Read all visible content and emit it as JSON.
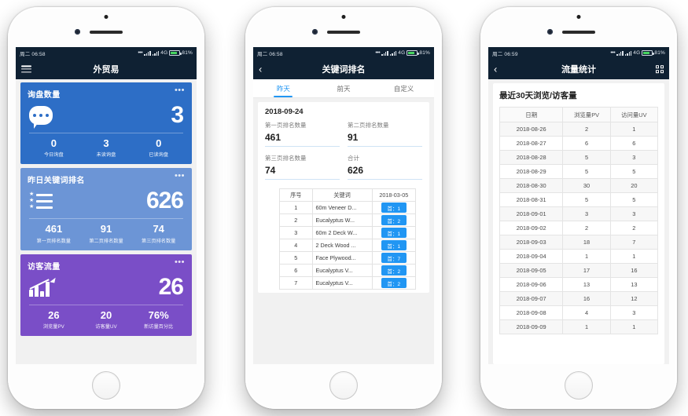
{
  "status_bar": {
    "day_time": "周二 06:58",
    "day_time_3": "周二 06:59",
    "network": "4G",
    "battery": "81%"
  },
  "phone1": {
    "nav_title": "外贸易",
    "cards": [
      {
        "title": "询盘数量",
        "icon": "speech-bubble-icon",
        "big_value": "3",
        "color": "#2d6ec6",
        "stats": [
          {
            "value": "0",
            "label": "今日询盘"
          },
          {
            "value": "3",
            "label": "未读询盘"
          },
          {
            "value": "0",
            "label": "已读询盘"
          }
        ]
      },
      {
        "title": "昨日关键词排名",
        "icon": "star-list-icon",
        "big_value": "626",
        "color": "#6c95d6",
        "stats": [
          {
            "value": "461",
            "label": "第一页排名数量"
          },
          {
            "value": "91",
            "label": "第二页排名数量"
          },
          {
            "value": "74",
            "label": "第三页排名数量"
          }
        ]
      },
      {
        "title": "访客流量",
        "icon": "growth-chart-icon",
        "big_value": "26",
        "color": "#7a4ec7",
        "stats": [
          {
            "value": "26",
            "label": "浏览量PV"
          },
          {
            "value": "20",
            "label": "访客量UV"
          },
          {
            "value": "76%",
            "label": "新访量百分比"
          }
        ]
      }
    ]
  },
  "phone2": {
    "nav_title": "关键词排名",
    "tabs": [
      {
        "label": "昨天",
        "active": true
      },
      {
        "label": "前天",
        "active": false
      },
      {
        "label": "自定义",
        "active": false
      }
    ],
    "panel_date": "2018-09-24",
    "fields": [
      {
        "label": "第一页排名数量",
        "value": "461"
      },
      {
        "label": "第二页排名数量",
        "value": "91"
      },
      {
        "label": "第三页排名数量",
        "value": "74"
      },
      {
        "label": "合计",
        "value": "626"
      }
    ],
    "keyword_table": {
      "headers": [
        "序号",
        "关键词",
        "2018-03-05"
      ],
      "rows": [
        [
          "1",
          "60m Veneer D...",
          "首：1"
        ],
        [
          "2",
          "Eucalyptus W...",
          "首：2"
        ],
        [
          "3",
          "60m 2 Deck W...",
          "首：1"
        ],
        [
          "4",
          "2 Deck Wood ...",
          "首：1"
        ],
        [
          "5",
          "Face Plywood...",
          "首：7"
        ],
        [
          "6",
          "Eucalyptus V...",
          "首：2"
        ],
        [
          "7",
          "Eucalyptus V...",
          "首：2"
        ]
      ]
    }
  },
  "phone3": {
    "nav_title": "流量统计",
    "grid_icon": "grid-squares-icon",
    "panel_title": "最近30天浏览/访客量",
    "traffic_table": {
      "headers": [
        "日期",
        "浏览量PV",
        "访问量UV"
      ],
      "rows": [
        [
          "2018-08-26",
          "2",
          "1"
        ],
        [
          "2018-08-27",
          "6",
          "6"
        ],
        [
          "2018-08-28",
          "5",
          "3"
        ],
        [
          "2018-08-29",
          "5",
          "5"
        ],
        [
          "2018-08-30",
          "30",
          "20"
        ],
        [
          "2018-08-31",
          "5",
          "5"
        ],
        [
          "2018-09-01",
          "3",
          "3"
        ],
        [
          "2018-09-02",
          "2",
          "2"
        ],
        [
          "2018-09-03",
          "18",
          "7"
        ],
        [
          "2018-09-04",
          "1",
          "1"
        ],
        [
          "2018-09-05",
          "17",
          "16"
        ],
        [
          "2018-09-06",
          "13",
          "13"
        ],
        [
          "2018-09-07",
          "16",
          "12"
        ],
        [
          "2018-09-08",
          "4",
          "3"
        ],
        [
          "2018-09-09",
          "1",
          "1"
        ]
      ]
    }
  }
}
